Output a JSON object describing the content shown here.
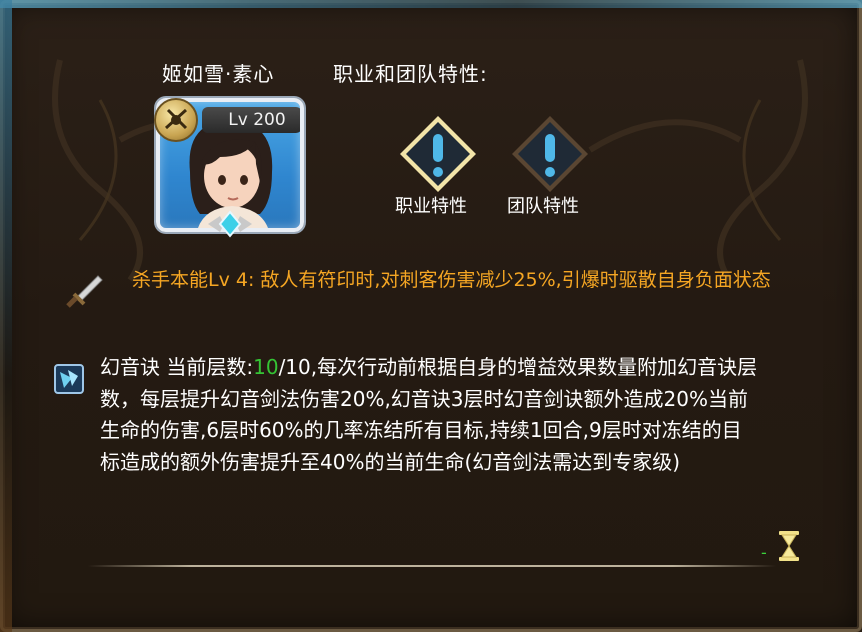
{
  "hero": {
    "name": "姬如雪·素心",
    "level": "Lv 200"
  },
  "traits": {
    "title": "职业和团队特性:",
    "class_trait_label": "职业特性",
    "team_trait_label": "团队特性"
  },
  "skill_passive": {
    "text": "杀手本能Lv 4: 敌人有符印时,对刺客伤害减少25%,引爆时驱散自身负面状态",
    "color": "#f5a623"
  },
  "skill_buff": {
    "prefix": "幻音诀 当前层数:",
    "current": "10",
    "rest": "/10,每次行动前根据自身的增益效果数量附加幻音诀层数，每层提升幻音剑法伤害20%,幻音诀3层时幻音剑诀额外造成20%当前生命的伤害,6层时60%的几率冻结所有目标,持续1回合,9层时对冻结的目标造成的额外伤害提升至40%的当前生命(幻音剑法需达到专家级)",
    "current_color": "#35c435"
  },
  "footer": {
    "dash": "-"
  },
  "icons": {
    "class_emblem": "crossed-blades-emblem-icon",
    "rank_gem": "diamond-gem-icon",
    "trait_class": "exclamation-diamond-icon",
    "trait_team": "exclamation-diamond-icon",
    "sword": "sword-icon",
    "buff": "buff-icon",
    "hourglass": "hourglass-icon"
  }
}
